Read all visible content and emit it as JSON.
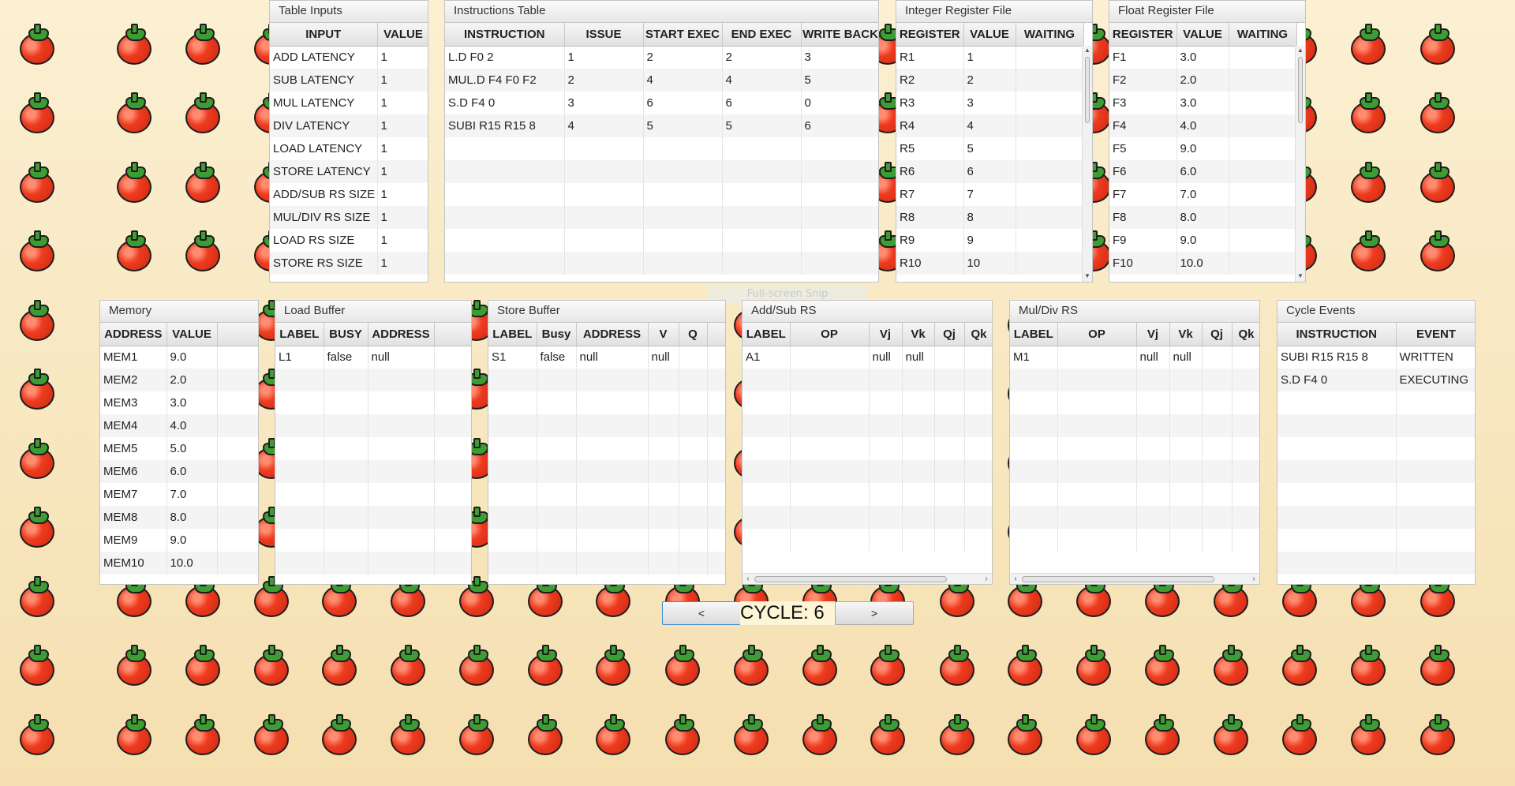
{
  "cycle": {
    "text": "CYCLE:  6",
    "prev_label": "<",
    "next_label": ">"
  },
  "overlay": {
    "label": "Full-screen Snip"
  },
  "table_inputs": {
    "title": "Table Inputs",
    "columns": [
      "INPUT",
      "VALUE"
    ],
    "rows": [
      [
        "ADD LATENCY",
        "1"
      ],
      [
        "SUB LATENCY",
        "1"
      ],
      [
        "MUL LATENCY",
        "1"
      ],
      [
        "DIV LATENCY",
        "1"
      ],
      [
        "LOAD LATENCY",
        "1"
      ],
      [
        "STORE LATENCY",
        "1"
      ],
      [
        "ADD/SUB RS SIZE",
        "1"
      ],
      [
        "MUL/DIV RS SIZE",
        "1"
      ],
      [
        "LOAD RS SIZE",
        "1"
      ],
      [
        "STORE RS SIZE",
        "1"
      ]
    ]
  },
  "instructions": {
    "title": "Instructions Table",
    "columns": [
      "INSTRUCTION",
      "ISSUE",
      "START EXEC",
      "END EXEC",
      "WRITE BACK"
    ],
    "rows": [
      [
        "L.D F0 2",
        "1",
        "2",
        "2",
        "3"
      ],
      [
        "MUL.D F4 F0 F2",
        "2",
        "4",
        "4",
        "5"
      ],
      [
        "S.D F4 0",
        "3",
        "6",
        "6",
        "0"
      ],
      [
        "SUBI R15 R15 8",
        "4",
        "5",
        "5",
        "6"
      ]
    ]
  },
  "int_regs": {
    "title": "Integer Register File",
    "columns": [
      "REGISTER",
      "VALUE",
      "WAITING"
    ],
    "rows": [
      [
        "R1",
        "1",
        ""
      ],
      [
        "R2",
        "2",
        ""
      ],
      [
        "R3",
        "3",
        ""
      ],
      [
        "R4",
        "4",
        ""
      ],
      [
        "R5",
        "5",
        ""
      ],
      [
        "R6",
        "6",
        ""
      ],
      [
        "R7",
        "7",
        ""
      ],
      [
        "R8",
        "8",
        ""
      ],
      [
        "R9",
        "9",
        ""
      ],
      [
        "R10",
        "10",
        ""
      ]
    ]
  },
  "float_regs": {
    "title": "Float Register File",
    "columns": [
      "REGISTER",
      "VALUE",
      "WAITING"
    ],
    "rows": [
      [
        "F1",
        "3.0",
        ""
      ],
      [
        "F2",
        "2.0",
        ""
      ],
      [
        "F3",
        "3.0",
        ""
      ],
      [
        "F4",
        "4.0",
        ""
      ],
      [
        "F5",
        "9.0",
        ""
      ],
      [
        "F6",
        "6.0",
        ""
      ],
      [
        "F7",
        "7.0",
        ""
      ],
      [
        "F8",
        "8.0",
        ""
      ],
      [
        "F9",
        "9.0",
        ""
      ],
      [
        "F10",
        "10.0",
        ""
      ]
    ]
  },
  "memory": {
    "title": "Memory",
    "columns": [
      "ADDRESS",
      "VALUE",
      ""
    ],
    "rows": [
      [
        "MEM1",
        "9.0",
        ""
      ],
      [
        "MEM2",
        "2.0",
        ""
      ],
      [
        "MEM3",
        "3.0",
        ""
      ],
      [
        "MEM4",
        "4.0",
        ""
      ],
      [
        "MEM5",
        "5.0",
        ""
      ],
      [
        "MEM6",
        "6.0",
        ""
      ],
      [
        "MEM7",
        "7.0",
        ""
      ],
      [
        "MEM8",
        "8.0",
        ""
      ],
      [
        "MEM9",
        "9.0",
        ""
      ],
      [
        "MEM10",
        "10.0",
        ""
      ]
    ]
  },
  "load_buffer": {
    "title": "Load Buffer",
    "columns": [
      "LABEL",
      "BUSY",
      "ADDRESS",
      ""
    ],
    "rows": [
      [
        "L1",
        "false",
        "null",
        ""
      ]
    ]
  },
  "store_buffer": {
    "title": "Store Buffer",
    "columns": [
      "LABEL",
      "Busy",
      "ADDRESS",
      "V",
      "Q",
      ""
    ],
    "rows": [
      [
        "S1",
        "false",
        "null",
        "null",
        "",
        ""
      ]
    ]
  },
  "addsub_rs": {
    "title": "Add/Sub RS",
    "columns": [
      "LABEL",
      "OP",
      "Vj",
      "Vk",
      "Qj",
      "Qk"
    ],
    "rows": [
      [
        "A1",
        "",
        "null",
        "null",
        "",
        ""
      ]
    ]
  },
  "muldiv_rs": {
    "title": "Mul/Div RS",
    "columns": [
      "LABEL",
      "OP",
      "Vj",
      "Vk",
      "Qj",
      "Qk"
    ],
    "rows": [
      [
        "M1",
        "",
        "null",
        "null",
        "",
        ""
      ]
    ]
  },
  "cycle_events": {
    "title": "Cycle Events",
    "columns": [
      "INSTRUCTION",
      "EVENT"
    ],
    "rows": [
      [
        "SUBI R15 R15 8",
        "WRITTEN"
      ],
      [
        "S.D F4 0",
        "EXECUTING"
      ]
    ]
  }
}
